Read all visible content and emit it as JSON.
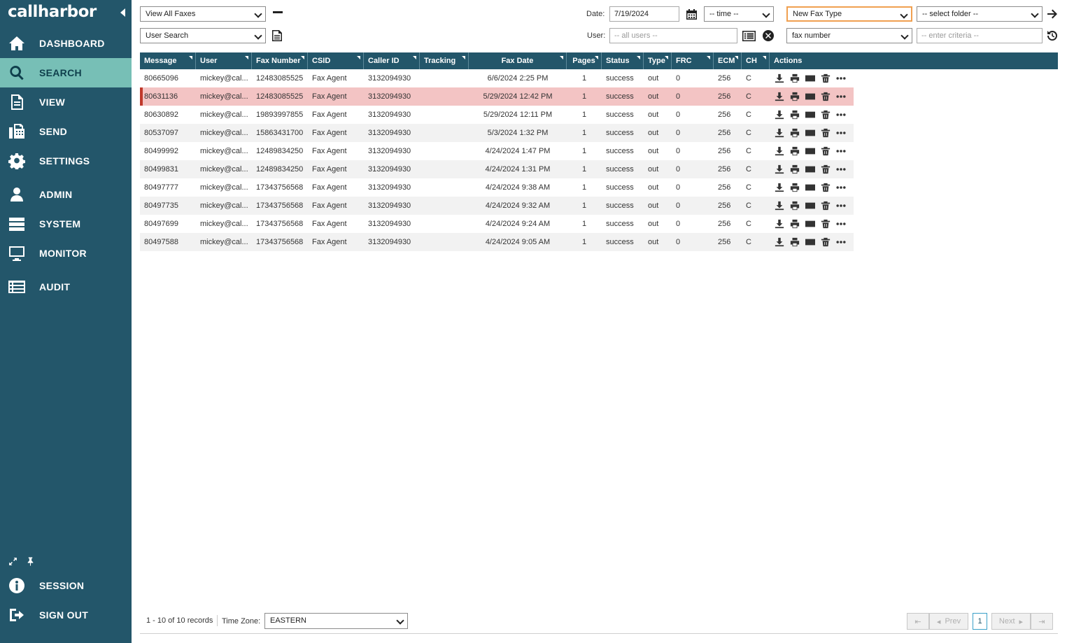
{
  "app": {
    "logo": "callharbor"
  },
  "sidebar": {
    "items": [
      {
        "label": "DASHBOARD",
        "icon": "home-icon"
      },
      {
        "label": "SEARCH",
        "icon": "search-icon"
      },
      {
        "label": "VIEW",
        "icon": "document-icon"
      },
      {
        "label": "SEND",
        "icon": "fax-icon"
      },
      {
        "label": "SETTINGS",
        "icon": "gear-icon"
      },
      {
        "label": "ADMIN",
        "icon": "user-icon"
      },
      {
        "label": "SYSTEM",
        "icon": "server-icon"
      },
      {
        "label": "MONITOR",
        "icon": "monitor-icon"
      },
      {
        "label": "AUDIT",
        "icon": "list-icon"
      }
    ],
    "active": "SEARCH",
    "bottom": [
      {
        "label": "SESSION",
        "icon": "info-icon"
      },
      {
        "label": "SIGN OUT",
        "icon": "sign-out-icon"
      }
    ]
  },
  "filters": {
    "view_select": "View All Faxes",
    "search_select": "User Search",
    "date_label": "Date:",
    "date_value": "7/19/2024",
    "time_select": "-- time --",
    "fax_type_select": "New Fax Type",
    "folder_select": "-- select folder --",
    "user_label": "User:",
    "user_placeholder": "-- all users --",
    "field_select": "fax number",
    "criteria_placeholder": "-- enter criteria --"
  },
  "table": {
    "columns": [
      "Message",
      "User",
      "Fax Number",
      "CSID",
      "Caller ID",
      "Tracking",
      "Fax Date",
      "Pages",
      "Status",
      "Type",
      "FRC",
      "ECM",
      "CH",
      "Actions"
    ],
    "rows": [
      [
        "80665096",
        "mickey@cal...",
        "12483085525",
        "Fax Agent",
        "3132094930",
        "",
        "6/6/2024 2:25 PM",
        "1",
        "success",
        "out",
        "0",
        "256",
        "C"
      ],
      [
        "80631136",
        "mickey@cal...",
        "12483085525",
        "Fax Agent",
        "3132094930",
        "",
        "5/29/2024 12:42 PM",
        "1",
        "success",
        "out",
        "0",
        "256",
        "C"
      ],
      [
        "80630892",
        "mickey@cal...",
        "19893997855",
        "Fax Agent",
        "3132094930",
        "",
        "5/29/2024 12:11 PM",
        "1",
        "success",
        "out",
        "0",
        "256",
        "C"
      ],
      [
        "80537097",
        "mickey@cal...",
        "15863431700",
        "Fax Agent",
        "3132094930",
        "",
        "5/3/2024 1:32 PM",
        "1",
        "success",
        "out",
        "0",
        "256",
        "C"
      ],
      [
        "80499992",
        "mickey@cal...",
        "12489834250",
        "Fax Agent",
        "3132094930",
        "",
        "4/24/2024 1:47 PM",
        "1",
        "success",
        "out",
        "0",
        "256",
        "C"
      ],
      [
        "80499831",
        "mickey@cal...",
        "12489834250",
        "Fax Agent",
        "3132094930",
        "",
        "4/24/2024 1:31 PM",
        "1",
        "success",
        "out",
        "0",
        "256",
        "C"
      ],
      [
        "80497777",
        "mickey@cal...",
        "17343756568",
        "Fax Agent",
        "3132094930",
        "",
        "4/24/2024 9:38 AM",
        "1",
        "success",
        "out",
        "0",
        "256",
        "C"
      ],
      [
        "80497735",
        "mickey@cal...",
        "17343756568",
        "Fax Agent",
        "3132094930",
        "",
        "4/24/2024 9:32 AM",
        "1",
        "success",
        "out",
        "0",
        "256",
        "C"
      ],
      [
        "80497699",
        "mickey@cal...",
        "17343756568",
        "Fax Agent",
        "3132094930",
        "",
        "4/24/2024 9:24 AM",
        "1",
        "success",
        "out",
        "0",
        "256",
        "C"
      ],
      [
        "80497588",
        "mickey@cal...",
        "17343756568",
        "Fax Agent",
        "3132094930",
        "",
        "4/24/2024 9:05 AM",
        "1",
        "success",
        "out",
        "0",
        "256",
        "C"
      ]
    ],
    "selected_row": 1,
    "row_actions": [
      "download-icon",
      "print-icon",
      "email-icon",
      "trash-icon",
      "more-icon"
    ]
  },
  "footer": {
    "records": "1 - 10 of 10 records",
    "timezone_label": "Time Zone:",
    "timezone_value": "EASTERN",
    "prev": "Prev",
    "next": "Next",
    "page": "1"
  },
  "colors": {
    "sidebar": "#23566a",
    "active": "#77bfb6",
    "header": "#23566a",
    "selected_row": "#f3c4c4",
    "selected_border": "#c0392b"
  }
}
